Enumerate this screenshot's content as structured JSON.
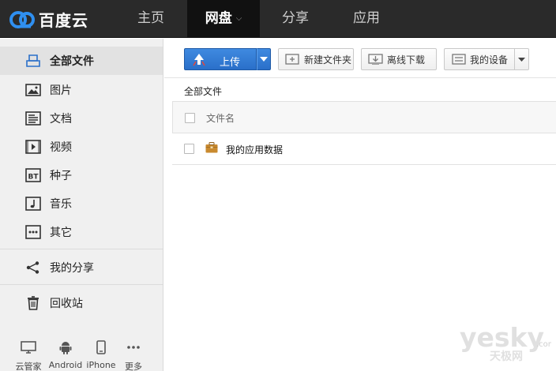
{
  "app": {
    "name": "百度云"
  },
  "nav": {
    "home": "主页",
    "pan": "网盘",
    "share": "分享",
    "app": "应用"
  },
  "sidebar": {
    "items": [
      {
        "label": "全部文件",
        "icon": "all-files-icon"
      },
      {
        "label": "图片",
        "icon": "image-icon"
      },
      {
        "label": "文档",
        "icon": "document-icon"
      },
      {
        "label": "视频",
        "icon": "video-icon"
      },
      {
        "label": "种子",
        "icon": "bt-icon"
      },
      {
        "label": "音乐",
        "icon": "music-icon"
      },
      {
        "label": "其它",
        "icon": "more-dots-icon"
      }
    ],
    "my_share": "我的分享",
    "recycle": "回收站",
    "devices": [
      {
        "label": "云管家",
        "icon": "monitor-icon"
      },
      {
        "label": "Android",
        "icon": "android-icon"
      },
      {
        "label": "iPhone",
        "icon": "iphone-icon"
      },
      {
        "label": "更多",
        "icon": "more-icon"
      }
    ]
  },
  "toolbar": {
    "upload": "上传",
    "new_folder": "新建文件夹",
    "offline_download": "离线下载",
    "my_devices": "我的设备"
  },
  "content": {
    "breadcrumb": "全部文件",
    "column_name": "文件名",
    "files": [
      {
        "name": "我的应用数据",
        "icon": "app-folder-icon"
      }
    ]
  },
  "watermark": {
    "text": "yesky",
    "sub": "天极网",
    "suffix": ".com"
  },
  "colors": {
    "topbar": "#2a2a2a",
    "accent": "#2a6fc9",
    "sidebar": "#f0f0f0"
  }
}
